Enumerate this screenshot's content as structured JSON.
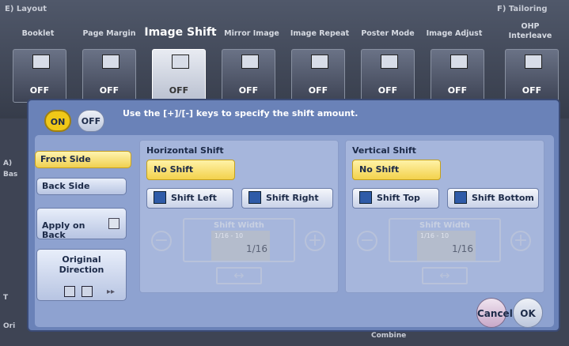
{
  "header": {
    "layout_label": "E)  Layout",
    "tailoring_label": "F)  Tailoring"
  },
  "tabs": [
    {
      "label": "Booklet",
      "status": "OFF"
    },
    {
      "label": "Page Margin",
      "status": "OFF"
    },
    {
      "label": "Image Shift",
      "status": "OFF"
    },
    {
      "label": "Mirror Image",
      "status": "OFF"
    },
    {
      "label": "Image Repeat",
      "status": "OFF"
    },
    {
      "label": "Poster Mode",
      "status": "OFF"
    },
    {
      "label": "Image Adjust",
      "status": "OFF"
    },
    {
      "label": "OHP\nInterleave",
      "status": "OFF"
    }
  ],
  "background": {
    "sec_a": "A)",
    "sec_a2": "Bas",
    "left_t": "T",
    "left_orig": "Ori",
    "combine": "Combine"
  },
  "dialog": {
    "on_label": "ON",
    "off_label": "OFF",
    "instruction": "Use the [+]/[-] keys to specify the shift amount.",
    "front_side": "Front Side",
    "back_side": "Back Side",
    "apply_on_back": "Apply on\nBack",
    "original_direction": "Original\nDirection",
    "horizontal": {
      "title": "Horizontal Shift",
      "no_shift": "No Shift",
      "left": "Shift Left",
      "right": "Shift Right"
    },
    "vertical": {
      "title": "Vertical Shift",
      "no_shift": "No Shift",
      "top": "Shift Top",
      "bottom": "Shift Bottom"
    },
    "shift_width": {
      "label": "Shift Width",
      "range": "1/16 - 10",
      "value": "1/16"
    },
    "cancel": "Cancel",
    "ok": "OK"
  }
}
